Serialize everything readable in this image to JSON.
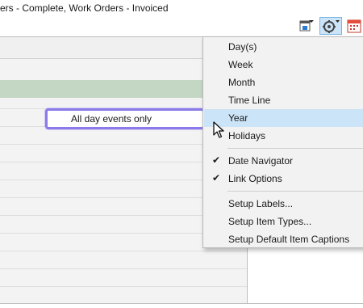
{
  "window": {
    "title": "ers - Complete, Work Orders - Invoiced"
  },
  "toolbar": {
    "icons": [
      "calendar-print-icon",
      "settings-dropdown-icon",
      "calendar-icon"
    ]
  },
  "popup": {
    "label": "All day events only"
  },
  "menu": {
    "items": [
      {
        "label": "Day(s)",
        "checked": false
      },
      {
        "label": "Week",
        "checked": false
      },
      {
        "label": "Month",
        "checked": false
      },
      {
        "label": "Time Line",
        "checked": false
      },
      {
        "label": "Year",
        "checked": false,
        "highlighted": true
      },
      {
        "label": "Holidays",
        "checked": false
      },
      {
        "label": "Date Navigator",
        "checked": true
      },
      {
        "label": "Link Options",
        "checked": true
      },
      {
        "label": "Setup Labels...",
        "checked": false
      },
      {
        "label": "Setup Item Types...",
        "checked": false
      },
      {
        "label": "Setup Default Item Captions",
        "checked": false
      }
    ],
    "check_glyph": "✔"
  },
  "colors": {
    "highlight": "#cce4f7",
    "popup_border": "#8b7bea",
    "allday_band": "#c4d6c4"
  }
}
